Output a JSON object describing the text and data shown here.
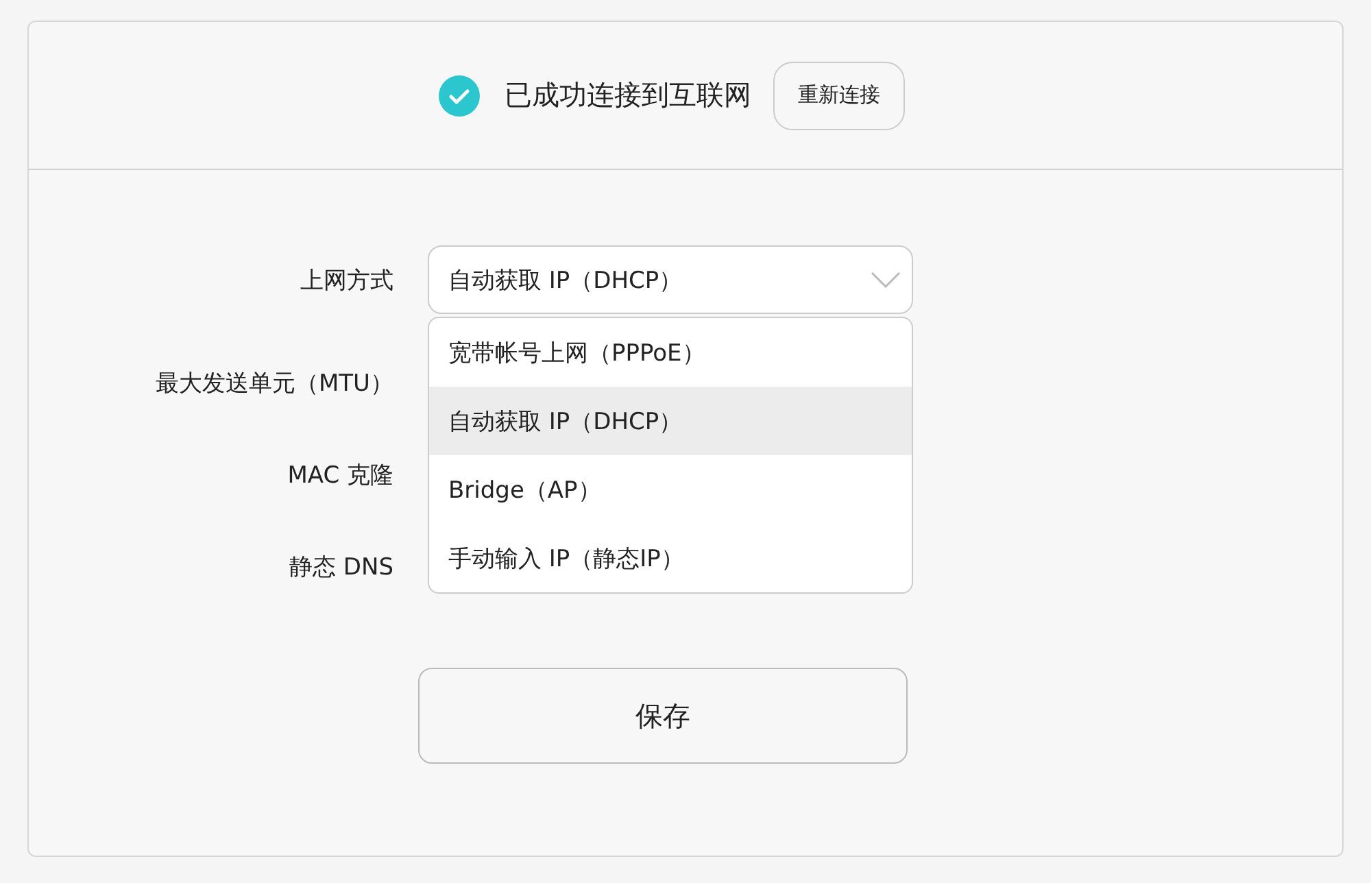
{
  "status": {
    "connected": true,
    "text": "已成功连接到互联网",
    "button": "重新连接"
  },
  "form": {
    "rows": [
      {
        "label": "上网方式",
        "kind": "select",
        "value": "自动获取 IP（DHCP）",
        "expanded": true
      },
      {
        "label": "最大发送单元（MTU）",
        "kind": "hidden"
      },
      {
        "label": "MAC 克隆",
        "kind": "hidden"
      },
      {
        "label": "静态 DNS",
        "kind": "hidden"
      }
    ],
    "options": [
      {
        "label": "宽带帐号上网（PPPoE）",
        "selected": false
      },
      {
        "label": "自动获取 IP（DHCP）",
        "selected": true
      },
      {
        "label": "Bridge（AP）",
        "selected": false
      },
      {
        "label": "手动输入 IP（静态IP）",
        "selected": false
      }
    ]
  },
  "save_button": "保存"
}
